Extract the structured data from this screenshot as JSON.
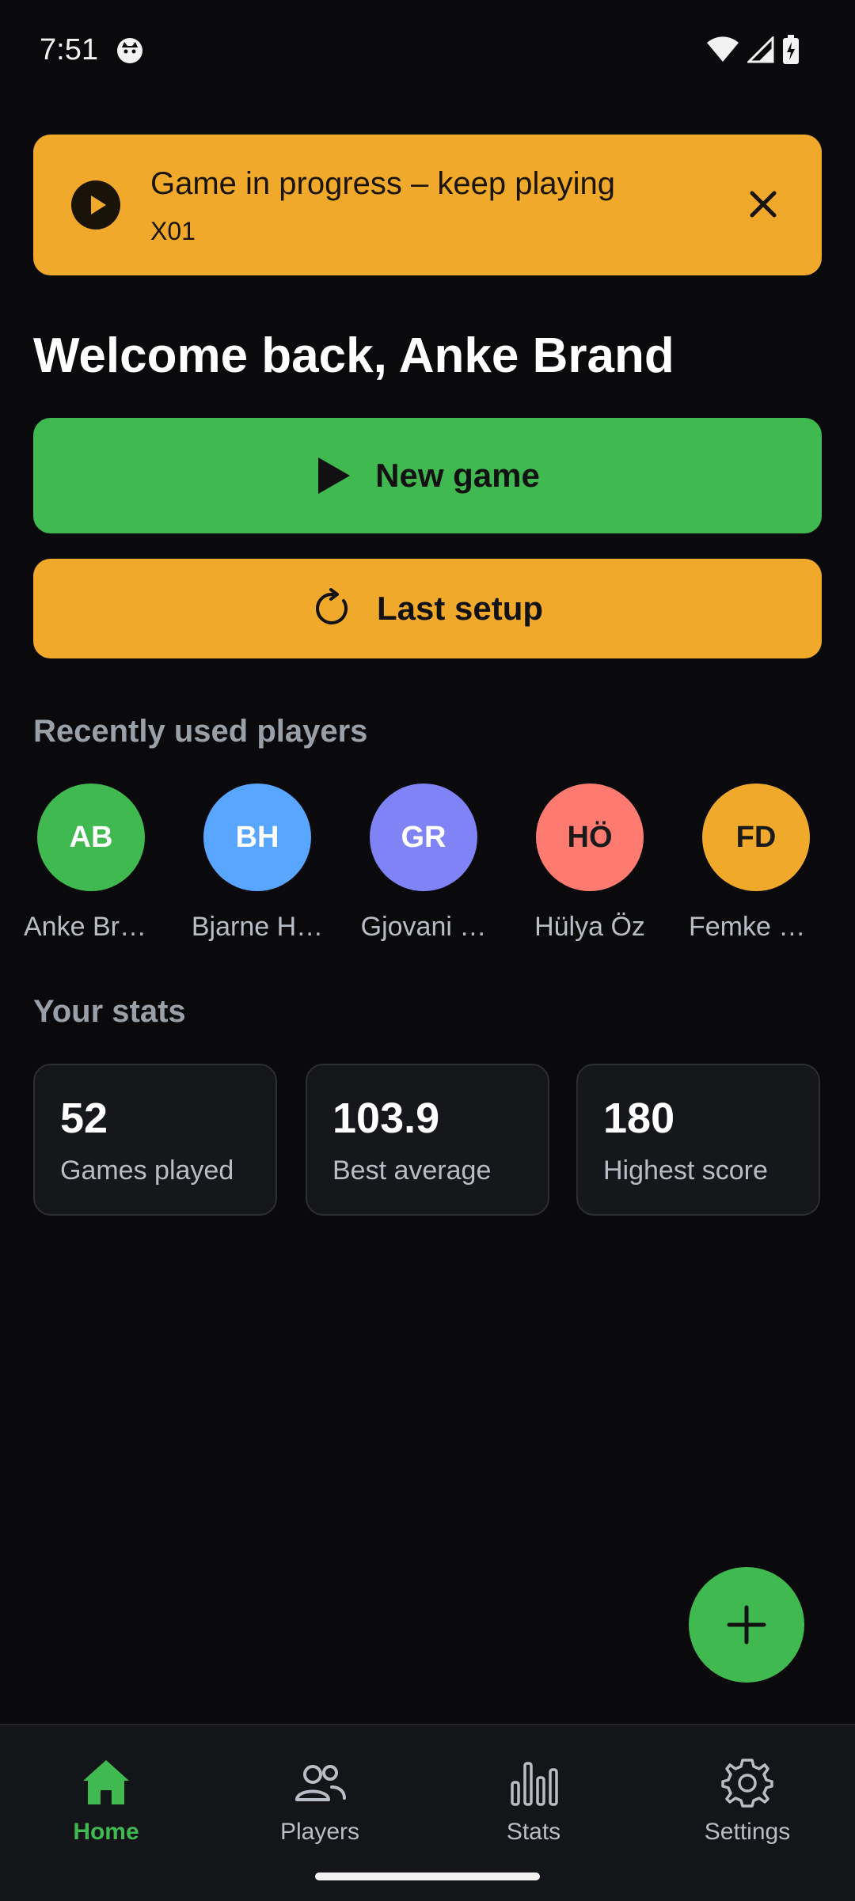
{
  "status_bar": {
    "time": "7:51"
  },
  "banner": {
    "title": "Game in progress – keep playing",
    "subtitle": "X01",
    "play_icon": "play-circle-icon",
    "close_icon": "close-icon",
    "color": "#f0a92a"
  },
  "welcome": {
    "text": "Welcome back, Anke Brand"
  },
  "actions": {
    "new_game_label": "New game",
    "new_game_icon": "play-icon",
    "new_game_color": "#3fb950",
    "last_setup_label": "Last setup",
    "last_setup_icon": "refresh-icon",
    "last_setup_color": "#f0a92a"
  },
  "recent_players": {
    "title": "Recently used players",
    "items": [
      {
        "initials": "AB",
        "name": "Anke Bra…",
        "color": "#3fb950"
      },
      {
        "initials": "BH",
        "name": "Bjarne H…",
        "color": "#58a6ff"
      },
      {
        "initials": "GR",
        "name": "Gjovani …",
        "color": "#7f83f6"
      },
      {
        "initials": "HÖ",
        "name": "Hülya Öz",
        "color": "#ff7b72"
      },
      {
        "initials": "FD",
        "name": "Femke D…",
        "color": "#f0a92a"
      }
    ]
  },
  "stats": {
    "title": "Your stats",
    "items": [
      {
        "value": "52",
        "label": "Games played"
      },
      {
        "value": "103.9",
        "label": "Best average"
      },
      {
        "value": "180",
        "label": "Highest score"
      }
    ]
  },
  "fab": {
    "icon": "plus-icon"
  },
  "nav": {
    "items": [
      {
        "label": "Home",
        "icon": "home-icon",
        "active": true
      },
      {
        "label": "Players",
        "icon": "players-icon",
        "active": false
      },
      {
        "label": "Stats",
        "icon": "bar-chart-icon",
        "active": false
      },
      {
        "label": "Settings",
        "icon": "gear-icon",
        "active": false
      }
    ]
  }
}
